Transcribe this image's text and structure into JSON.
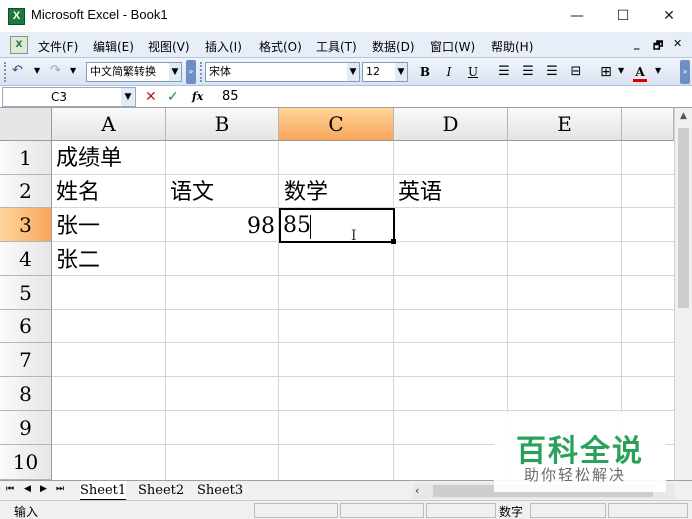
{
  "window": {
    "title": "Microsoft Excel - Book1",
    "app_icon": "X",
    "minimize": "—",
    "maximize": "☐",
    "close": "✕"
  },
  "menubar": {
    "items": [
      "文件(F)",
      "编辑(E)",
      "视图(V)",
      "插入(I)",
      "格式(O)",
      "工具(T)",
      "数据(D)",
      "窗口(W)",
      "帮助(H)"
    ],
    "right_min": "_",
    "right_restore": "🗗",
    "right_close": "✕"
  },
  "toolbar": {
    "undo": "↶",
    "redo": "↷",
    "convert_combo": "中文简繁转换",
    "font": "宋体",
    "font_size": "12",
    "bold": "B",
    "italic": "I",
    "underline": "U",
    "font_color_letter": "A",
    "colors": {
      "font_color_bar": "#e00000",
      "accent": "#2b4f8a"
    }
  },
  "formulabar": {
    "name_box": "C3",
    "cancel": "✕",
    "enter": "✓",
    "fx": "fx",
    "value": "85"
  },
  "grid": {
    "columns": [
      "A",
      "B",
      "C",
      "D",
      "E"
    ],
    "rows": [
      "1",
      "2",
      "3",
      "4",
      "5",
      "6",
      "7",
      "8",
      "9",
      "10"
    ],
    "selected_column": "C",
    "selected_row": "3",
    "cells": {
      "A1": "成绩单",
      "A2": "姓名",
      "B2": "语文",
      "C2": "数学",
      "D2": "英语",
      "A3": "张一",
      "B3": "98",
      "C3": "85",
      "A4": "张二"
    }
  },
  "tabs": {
    "sheets": [
      "Sheet1",
      "Sheet2",
      "Sheet3"
    ],
    "active": "Sheet1"
  },
  "statusbar": {
    "mode": "输入",
    "num_indicator": "数字"
  },
  "watermark": {
    "title": "百科全说",
    "subtitle": "助你轻松解决"
  }
}
